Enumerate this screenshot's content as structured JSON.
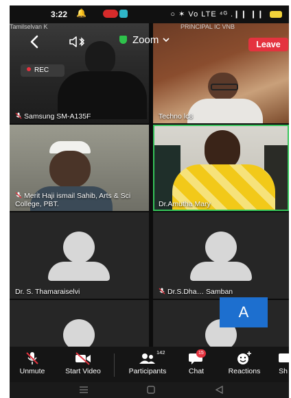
{
  "status_bar": {
    "time": "3:22",
    "right_indicators": "○ ✶ Vo LTE ⁴ᴳ .❙❙ ❙❙",
    "icons": [
      "notification-bell-icon",
      "app-notification-icon",
      "alarm-icon",
      "vibrate-icon",
      "signal-icon",
      "battery-icon"
    ]
  },
  "meeting_header": {
    "title": "Zoom",
    "leave_label": "Leave",
    "recording_label": "REC",
    "top_cut_names": [
      "Tamilselvan K",
      "PRINCIPAL IC VNB"
    ]
  },
  "participants": [
    {
      "name": "Samsung SM-A135F",
      "muted": true
    },
    {
      "name": "Techno lc8",
      "muted": false
    },
    {
      "name": "Merit Haji ismail Sahib, Arts & Sci College, PBT.",
      "muted": true
    },
    {
      "name": "Dr.Amutha Mary",
      "muted": false,
      "active_speaker": true
    },
    {
      "name": "Dr. S. Thamaraiselvi",
      "muted": false
    },
    {
      "name": "Dr.S.Dha… Samban",
      "muted": true
    },
    {
      "name": "",
      "muted": false
    },
    {
      "name": "",
      "muted": false,
      "letter": "A"
    }
  ],
  "toolbar": {
    "unmute_label": "Unmute",
    "start_video_label": "Start Video",
    "participants_label": "Participants",
    "participants_count": "142",
    "chat_label": "Chat",
    "chat_badge": "15",
    "reactions_label": "Reactions",
    "share_label": "Sh"
  },
  "colors": {
    "leave_red": "#e4333f",
    "active_speaker_green": "#36c45a",
    "avatar_blue": "#1d6fcf",
    "toolbar_bg": "#151515"
  }
}
